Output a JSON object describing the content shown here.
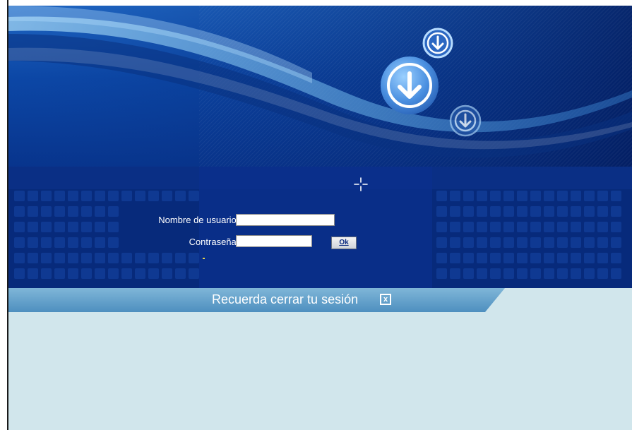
{
  "login": {
    "username_label": "Nombre de usuario :",
    "username_value": "",
    "password_label": "Contraseña :",
    "password_value": "",
    "ok_label": "Ok"
  },
  "banner": {
    "text": "Recuerda cerrar tu sesión",
    "close_symbol": "x"
  },
  "icons": [
    "download-arrow-icon",
    "sparkle-icon",
    "close-icon"
  ],
  "colors": {
    "hero_blue": "#0b3f96",
    "deep_blue": "#072a7b",
    "banner_blue": "#5b9cc4",
    "lower_panel": "#d1e6ec"
  }
}
